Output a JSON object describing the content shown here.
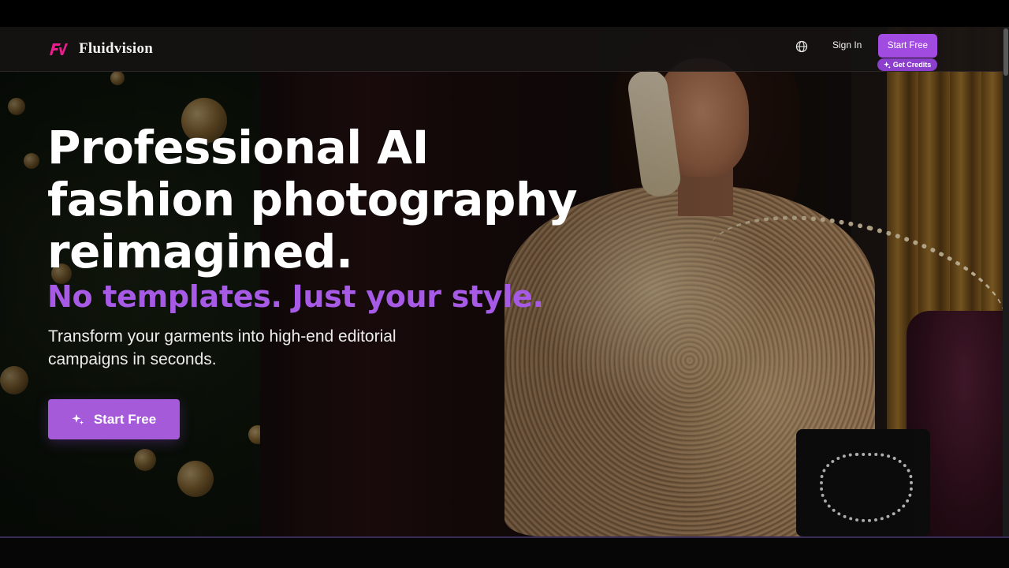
{
  "brand": {
    "logo_mark": "FV",
    "name": "Fluidvision"
  },
  "nav": {
    "language_icon": "globe-icon",
    "sign_in": "Sign In",
    "start_free": "Start Free",
    "get_credits": "Get Credits"
  },
  "hero": {
    "title_lines": [
      "Professional AI",
      "fashion photography",
      "reimagined."
    ],
    "subtitle": "No templates. Just your style.",
    "description": "Transform your garments into high-end editorial campaigns in seconds.",
    "cta_label": "Start Free",
    "cta_icon": "sparkle-icon"
  },
  "colors": {
    "accent": "#a14be0",
    "accent_text": "#a65ae6",
    "logo": "#e91e8c"
  }
}
